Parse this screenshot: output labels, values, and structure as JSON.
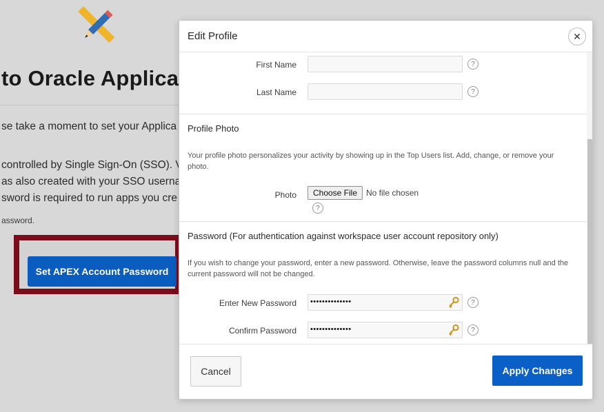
{
  "background": {
    "heading": "to Oracle Applicati",
    "lines": [
      "se take a moment to set your Applica",
      "controlled by Single Sign-On (SSO). V",
      "as also created with your SSO usernan",
      "sword is required to run apps you cre"
    ],
    "small_line": "assword.",
    "button_label": "Set APEX Account Password",
    "highlight_color": "#7a0c1c",
    "button_color": "#0a5cbf"
  },
  "dialog": {
    "title": "Edit Profile",
    "close_glyph": "✕",
    "fields": {
      "first_name": {
        "label": "First Name",
        "value": ""
      },
      "last_name": {
        "label": "Last Name",
        "value": ""
      }
    },
    "profile_photo": {
      "title": "Profile Photo",
      "description": "Your profile photo personalizes your activity by showing up in the Top Users list. Add, change, or remove your photo.",
      "photo_label": "Photo",
      "choose_file_label": "Choose File",
      "file_status": "No file chosen"
    },
    "password": {
      "title": "Password (For authentication against workspace user account repository only)",
      "description": "If you wish to change your password, enter a new password. Otherwise, leave the password columns null and the current password will not be changed.",
      "new_label": "Enter New Password",
      "new_value": "••••••••••••••",
      "confirm_label": "Confirm Password",
      "confirm_value": "••••••••••••••"
    },
    "help_glyph": "?",
    "footer": {
      "cancel_label": "Cancel",
      "apply_label": "Apply Changes"
    },
    "accent_color": "#0a60c6"
  }
}
